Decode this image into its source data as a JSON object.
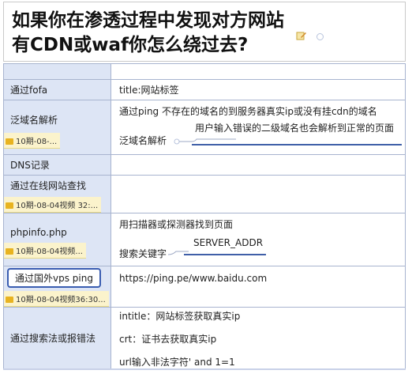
{
  "title": {
    "line1": "如果你在渗透过程中发现对方网站",
    "line2": "有CDN或waf你怎么绕过去?",
    "icons": [
      "pencil-icon",
      "collapse-circle-icon"
    ]
  },
  "rows": [
    {
      "left": "通过fofa",
      "right": [
        "title:网站标签"
      ]
    },
    {
      "left": "泛域名解析",
      "note": "10期-08-...",
      "right_top": "通过ping 不存在的域名的到服务器真实ip或没有挂cdn的域名",
      "right_label": "泛域名解析",
      "right_branch": "用户输入错误的二级域名也会解析到正常的页面"
    },
    {
      "left": "DNS记录"
    },
    {
      "left": "通过在线网站查找",
      "note": "10期-08-04视频 32:..."
    },
    {
      "left": "phpinfo.php",
      "note": "10期-08-04视频...",
      "right_top": "用扫描器或探测器找到页面",
      "right_label": "搜索关键字",
      "right_branch": "SERVER_ADDR"
    },
    {
      "left": "通过国外vps ping",
      "note": "10期-08-04视频36:30...",
      "right": [
        "https://ping.pe/www.baidu.com"
      ]
    },
    {
      "left": "通过搜索法或报错法",
      "right": [
        "intitle：网站标签获取真实ip",
        "crt：证书去获取真实ip",
        "url输入非法字符' and 1=1"
      ]
    }
  ]
}
